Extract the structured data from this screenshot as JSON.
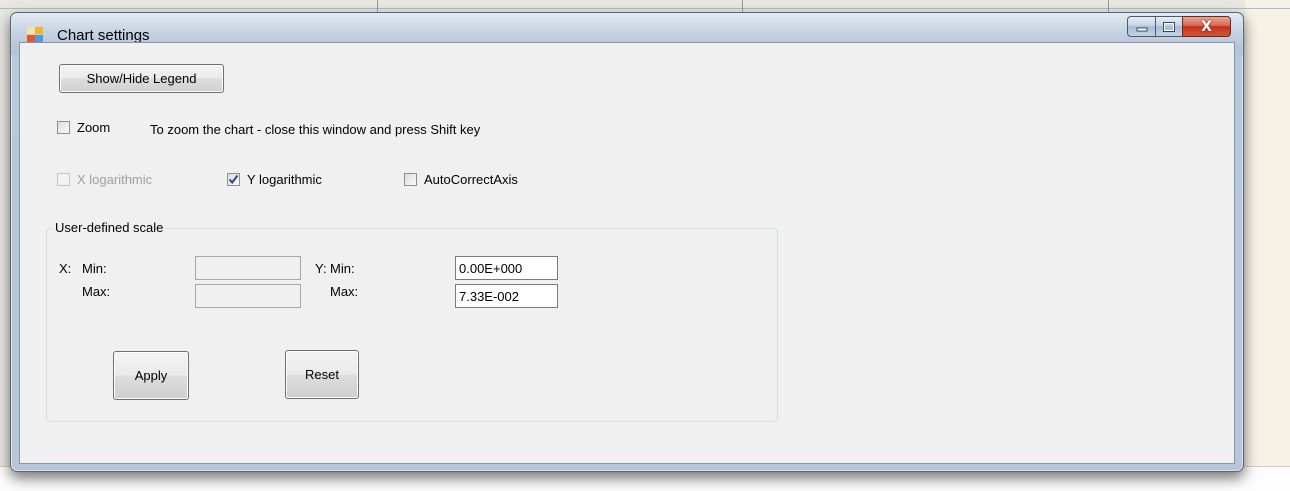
{
  "window": {
    "title": "Chart settings",
    "close_glyph": "X",
    "minimize_glyph": "—",
    "maximize_glyph": "□"
  },
  "toolbar": {
    "legend_button": "Show/Hide Legend"
  },
  "zoom": {
    "checkbox_label": "Zoom",
    "checked": false,
    "hint": "To zoom the chart - close this window and press Shift key"
  },
  "axis_options": {
    "x_log_label": "X logarithmic",
    "x_log_checked": false,
    "x_log_enabled": false,
    "y_log_label": "Y logarithmic",
    "y_log_checked": true,
    "auto_correct_label": "AutoCorrectAxis",
    "auto_correct_checked": false
  },
  "scale": {
    "group_title": "User-defined scale",
    "x_label": "X:",
    "y_label": "Y:",
    "min_label": "Min:",
    "max_label": "Max:",
    "x_min": "",
    "x_max": "",
    "y_min": "0.00E+000",
    "y_max": "7.33E-002"
  },
  "actions": {
    "apply": "Apply",
    "reset": "Reset"
  },
  "colors": {
    "check_mark": "#2a4b8d",
    "close_button": "#c2321c"
  }
}
